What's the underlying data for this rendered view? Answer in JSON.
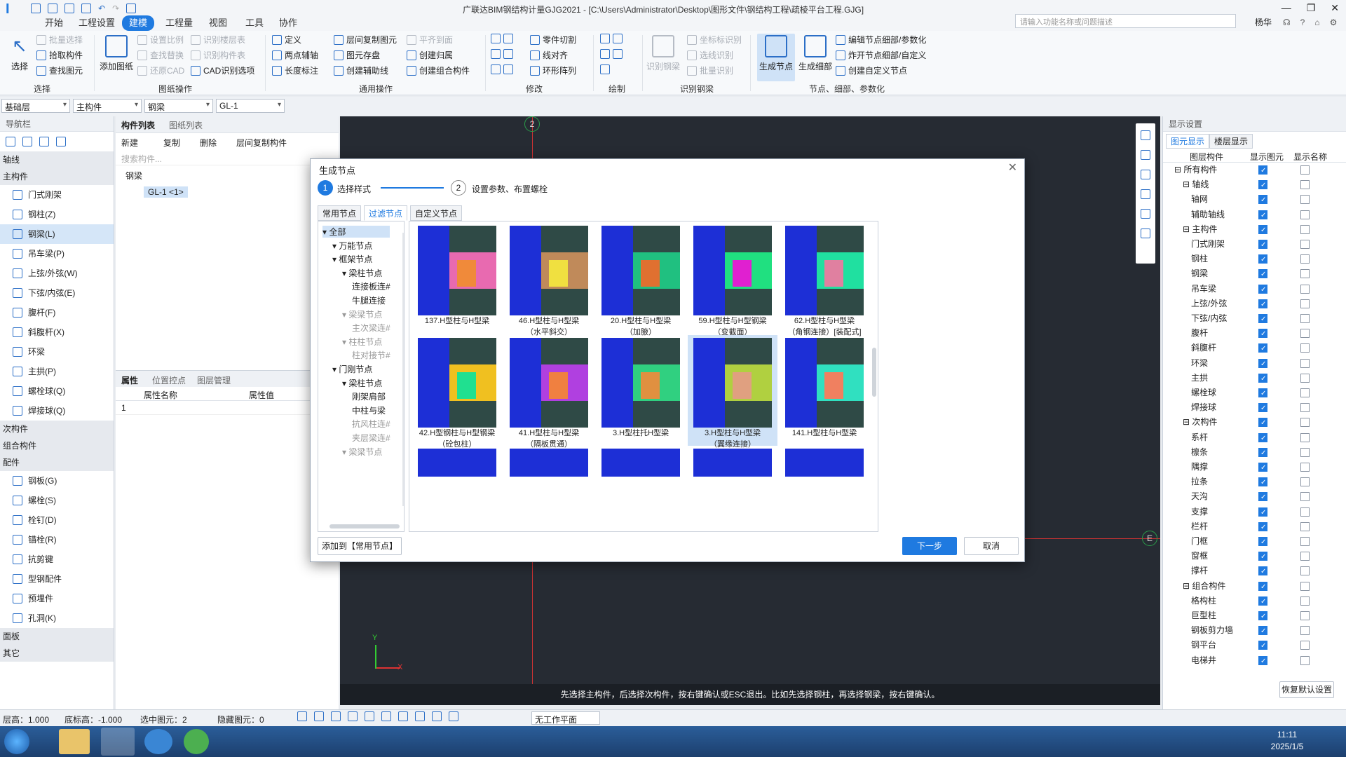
{
  "app": {
    "title": "广联达BIM钢结构计量GJG2021 - [C:\\Users\\Administrator\\Desktop\\图形文件\\钢结构工程\\疏棱平台工程.GJG]",
    "search_placeholder": "请输入功能名称或问题描述",
    "user": "杨华"
  },
  "tabs": [
    "开始",
    "工程设置",
    "建模",
    "工程量",
    "视图",
    "工具",
    "协作"
  ],
  "ribbon": {
    "select": {
      "big": "选择",
      "items": [
        "批量选择",
        "拾取构件",
        "查找图元"
      ],
      "group": "选择"
    },
    "drawing": {
      "big": "添加图纸",
      "items": [
        "设置比例",
        "查找替换",
        "还原CAD",
        "识别楼层表",
        "识别构件表",
        "CAD识别选项"
      ],
      "group": "图纸操作"
    },
    "common": {
      "items": [
        "定义",
        "两点辅轴",
        "长度标注",
        "层间复制图元",
        "图元存盘",
        "创建辅助线",
        "平齐到面",
        "创建归属",
        "创建组合构件"
      ],
      "group": "通用操作"
    },
    "modify": {
      "items": [
        "零件切割",
        "线对齐",
        "环形阵列"
      ],
      "group": "修改"
    },
    "draw": {
      "group": "绘制"
    },
    "recognize": {
      "big": "识别钢梁",
      "items": [
        "坐标标识别",
        "选线识别",
        "批量识别"
      ],
      "group": "识别钢梁"
    },
    "nodes": {
      "big1": "生成节点",
      "big2": "生成细部",
      "items": [
        "编辑节点细部/参数化",
        "炸开节点细部/自定义",
        "创建自定义节点"
      ],
      "group": "节点、细部、参数化"
    }
  },
  "combos": [
    "基础层",
    "主构件",
    "钢梁",
    "GL-1"
  ],
  "nav": {
    "title": "导航栏",
    "sections": [
      {
        "label": "轴线",
        "items": []
      },
      {
        "label": "主构件",
        "items": [
          "门式刚架",
          "钢柱(Z)",
          "钢梁(L)",
          "吊车梁(P)",
          "上弦/外弦(W)",
          "下弦/内弦(E)",
          "腹杆(F)",
          "斜腹杆(X)",
          "环梁",
          "主拱(P)",
          "螺栓球(Q)",
          "焊接球(Q)"
        ]
      },
      {
        "label": "次构件",
        "items": []
      },
      {
        "label": "组合构件",
        "items": []
      },
      {
        "label": "配件",
        "items": [
          "钢板(G)",
          "螺栓(S)",
          "栓钉(D)",
          "锚栓(R)",
          "抗剪键",
          "型钢配件",
          "预埋件",
          "孔洞(K)"
        ]
      },
      {
        "label": "面板",
        "items": []
      },
      {
        "label": "其它",
        "items": []
      }
    ],
    "selected": "钢梁(L)"
  },
  "comp": {
    "tabs": [
      "构件列表",
      "图纸列表"
    ],
    "toolbar": [
      "新建",
      "复制",
      "删除",
      "层间复制构件"
    ],
    "search": "搜索构件...",
    "tree_root": "钢梁",
    "tree_item": "GL-1 <1>",
    "prop_tabs": [
      "属性",
      "位置控点",
      "图层管理"
    ],
    "prop_cols": [
      "属性名称",
      "属性值"
    ],
    "prop_row": "1"
  },
  "canvas": {
    "axis_top": "2",
    "axis_right": "E",
    "hint": "先选择主构件，后选择次构件，按右键确认或ESC退出。比如先选择钢柱，再选择钢梁，按右键确认。",
    "x": "X",
    "y": "Y"
  },
  "right": {
    "title": "显示设置",
    "tabs": [
      "图元显示",
      "楼层显示"
    ],
    "cols": [
      "图层构件",
      "显示图元",
      "显示名称"
    ],
    "rows": [
      [
        "所有构件",
        0
      ],
      [
        "轴线",
        1
      ],
      [
        "轴网",
        2
      ],
      [
        "辅助轴线",
        2
      ],
      [
        "主构件",
        1
      ],
      [
        "门式刚架",
        2
      ],
      [
        "钢柱",
        2
      ],
      [
        "钢梁",
        2
      ],
      [
        "吊车梁",
        2
      ],
      [
        "上弦/外弦",
        2
      ],
      [
        "下弦/内弦",
        2
      ],
      [
        "腹杆",
        2
      ],
      [
        "斜腹杆",
        2
      ],
      [
        "环梁",
        2
      ],
      [
        "主拱",
        2
      ],
      [
        "螺栓球",
        2
      ],
      [
        "焊接球",
        2
      ],
      [
        "次构件",
        1
      ],
      [
        "系杆",
        2
      ],
      [
        "檩条",
        2
      ],
      [
        "隅撑",
        2
      ],
      [
        "拉条",
        2
      ],
      [
        "天沟",
        2
      ],
      [
        "支撑",
        2
      ],
      [
        "栏杆",
        2
      ],
      [
        "门框",
        2
      ],
      [
        "窗框",
        2
      ],
      [
        "撑杆",
        2
      ],
      [
        "组合构件",
        1
      ],
      [
        "格构柱",
        2
      ],
      [
        "巨型柱",
        2
      ],
      [
        "钢板剪力墙",
        2
      ],
      [
        "钢平台",
        2
      ],
      [
        "电梯井",
        2
      ]
    ],
    "reset": "恢复默认设置"
  },
  "status": {
    "floor_h": "层高：1.000",
    "bottom": "底标高：-1.000",
    "selected": "选中图元：2",
    "hidden": "隐藏图元：0",
    "plane": "无工作平面"
  },
  "dialog": {
    "title": "生成节点",
    "step1": "选择样式",
    "step1_num": "1",
    "step2": "设置参数、布置螺栓",
    "step2_num": "2",
    "tabs": [
      "常用节点",
      "过滤节点",
      "自定义节点"
    ],
    "tree": [
      [
        "全部",
        0
      ],
      [
        "万能节点",
        1
      ],
      [
        "框架节点",
        1
      ],
      [
        "梁柱节点",
        2
      ],
      [
        "连接板连#",
        3
      ],
      [
        "牛腿连接",
        3
      ],
      [
        "梁梁节点",
        2
      ],
      [
        "主次梁连#",
        3
      ],
      [
        "柱柱节点",
        2
      ],
      [
        "柱对接节#",
        3
      ],
      [
        "门刚节点",
        1
      ],
      [
        "梁柱节点",
        2
      ],
      [
        "刚架肩部",
        3
      ],
      [
        "中柱与梁",
        3
      ],
      [
        "抗风柱连#",
        3
      ],
      [
        "夹层梁连#",
        3
      ],
      [
        "梁梁节点",
        2
      ]
    ],
    "cards": [
      [
        "137.H型柱与H型梁",
        ""
      ],
      [
        "46.H型柱与H型梁",
        "（水平斜交）"
      ],
      [
        "20.H型柱与H型梁",
        "（加腋）"
      ],
      [
        "59.H型柱与H型钢梁",
        "（变截面）"
      ],
      [
        "62.H型柱与H型梁",
        "（角钢连接）[装配式]"
      ],
      [
        "42.H型钢柱与H型钢梁",
        "（砼包柱）"
      ],
      [
        "41.H型柱与H型梁",
        "（隔板贯通）"
      ],
      [
        "3.H型柱托H型梁",
        ""
      ],
      [
        "3.H型柱与H型梁",
        "（翼缘连接）"
      ],
      [
        "141.H型柱与H型梁",
        ""
      ]
    ],
    "selected_card": 8,
    "add_btn": "添加到【常用节点】",
    "next": "下一步",
    "cancel": "取消"
  },
  "taskbar": {
    "time": "11:11",
    "date": "2025/1/5"
  }
}
